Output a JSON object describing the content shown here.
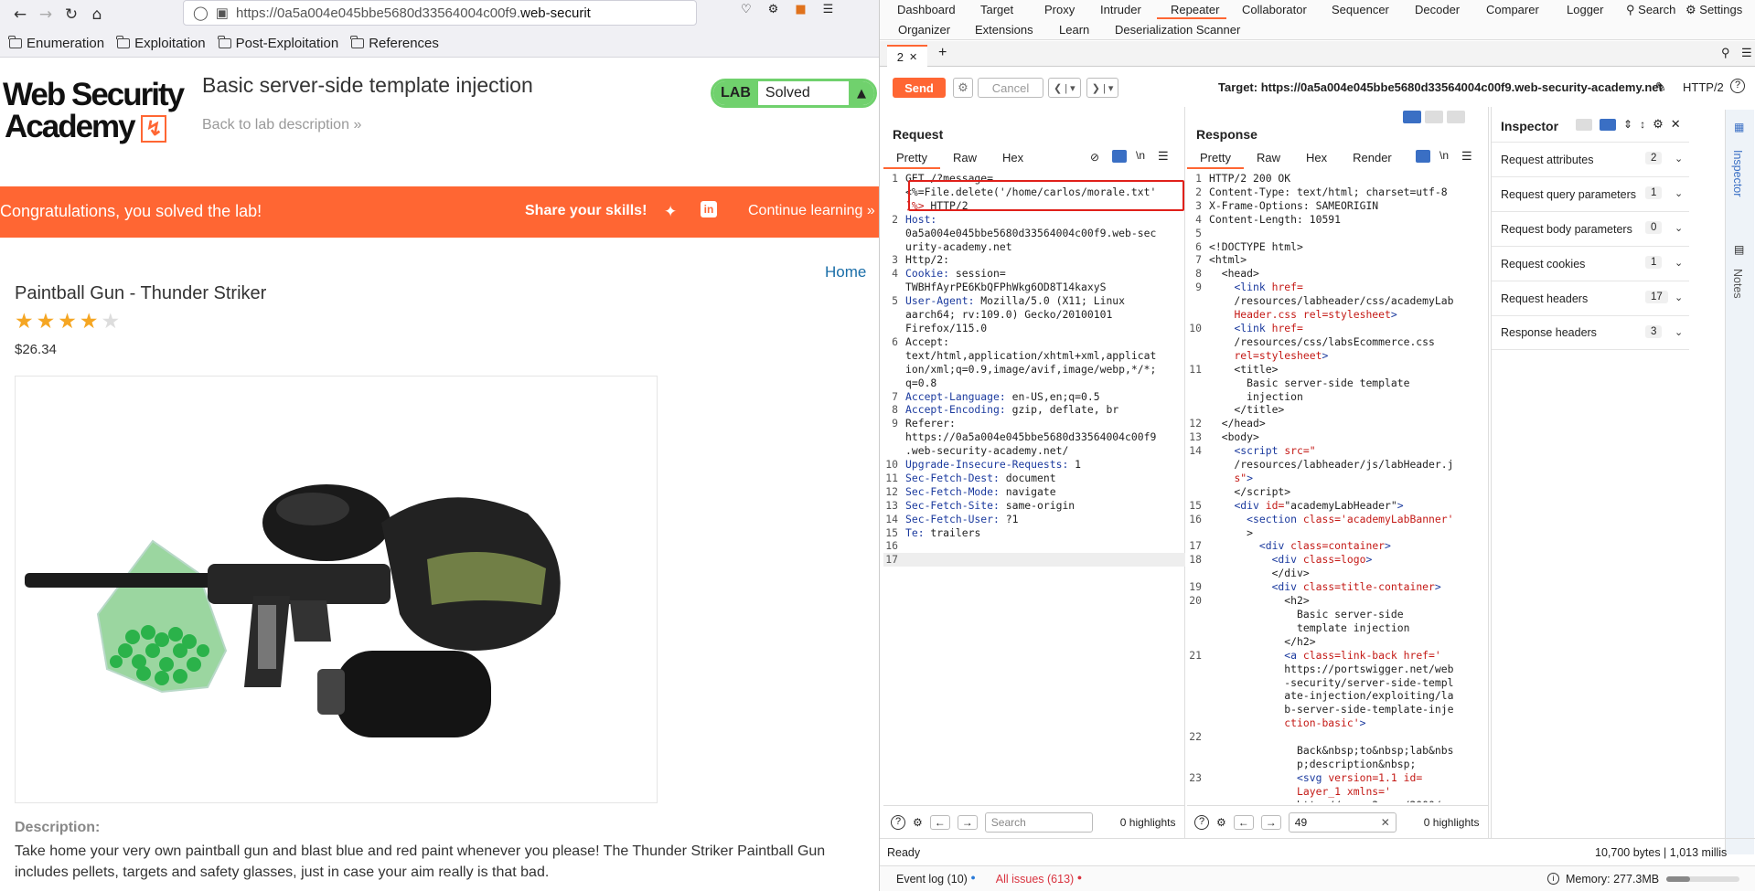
{
  "browser": {
    "url_pre": "https://0a5a004e045bbe5680d33564004c00f9.",
    "url_domain": "web-securit",
    "bookmarks": [
      "Enumeration",
      "Exploitation",
      "Post-Exploitation",
      "References"
    ]
  },
  "lab": {
    "logo_line1": "Web Security",
    "logo_line2": "Academy",
    "title": "Basic server-side template injection",
    "back_link": "Back to lab description",
    "badge_label": "LAB",
    "status": "Solved",
    "congrats": "Congratulations, you solved the lab!",
    "share": "Share your skills!",
    "continue": "Continue learning",
    "home": "Home",
    "product_name": "Paintball Gun - Thunder Striker",
    "rating": 4,
    "rating_max": 5,
    "price": "$26.34",
    "desc_heading": "Description:",
    "desc_line1": "Take home your very own paintball gun and blast blue and red paint whenever you please! The Thunder Striker Paintball Gun",
    "desc_line2": "includes pellets, targets and safety glasses, just in case your aim really is that bad."
  },
  "burp": {
    "tabs_row1": [
      "Dashboard",
      "Target",
      "Proxy",
      "Intruder",
      "Repeater",
      "Collaborator",
      "Sequencer",
      "Decoder",
      "Comparer",
      "Logger"
    ],
    "tabs_row2": [
      "Organizer",
      "Extensions",
      "Learn",
      "Deserialization Scanner"
    ],
    "search": "Search",
    "settings": "Settings",
    "repeater_tab": "2",
    "send": "Send",
    "cancel": "Cancel",
    "target": "Target: https://0a5a004e045bbe5680d33564004c00f9.web-security-academy.net",
    "protocol": "HTTP/2",
    "request": {
      "title": "Request",
      "tabs": [
        "Pretty",
        "Raw",
        "Hex"
      ],
      "search_placeholder": "Search",
      "highlights": "0 highlights"
    },
    "response": {
      "title": "Response",
      "tabs": [
        "Pretty",
        "Raw",
        "Hex",
        "Render"
      ],
      "search_value": "49",
      "highlights": "0 highlights"
    },
    "inspector": {
      "title": "Inspector",
      "rows": [
        {
          "label": "Request attributes",
          "count": "2"
        },
        {
          "label": "Request query parameters",
          "count": "1"
        },
        {
          "label": "Request body parameters",
          "count": "0"
        },
        {
          "label": "Request cookies",
          "count": "1"
        },
        {
          "label": "Request headers",
          "count": "17"
        },
        {
          "label": "Response headers",
          "count": "3"
        }
      ]
    },
    "side": {
      "inspector": "Inspector",
      "notes": "Notes"
    },
    "status": "Ready",
    "size": "10,700 bytes | 1,013 millis",
    "event_log": "Event log (10)",
    "issues": "All issues (613)",
    "memory": "Memory: 277.3MB"
  }
}
